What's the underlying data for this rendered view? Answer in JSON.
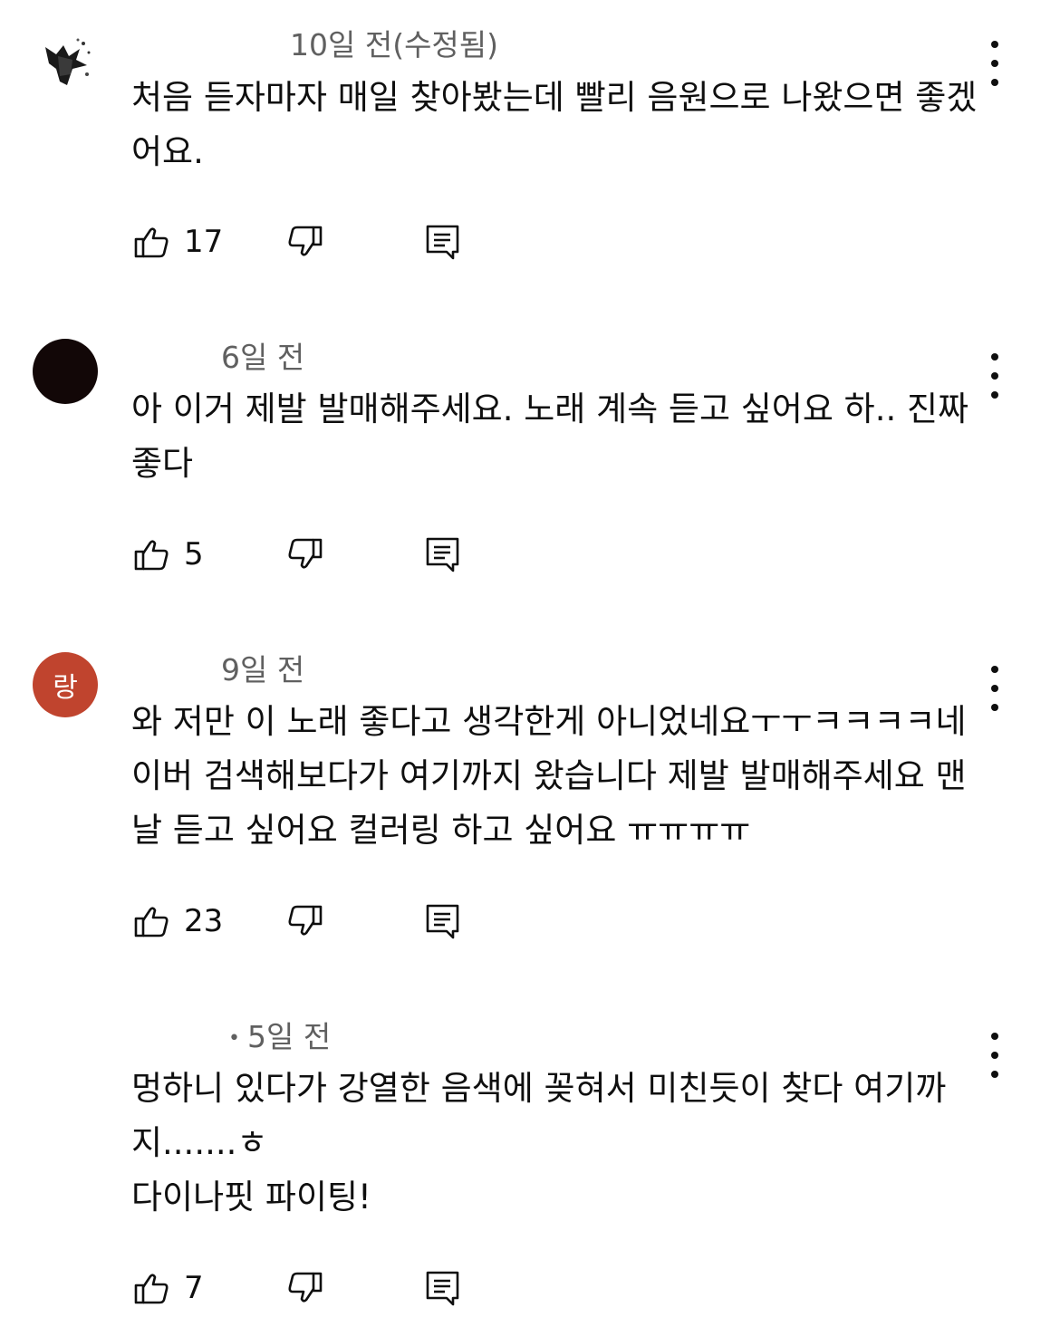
{
  "comments": [
    {
      "time": "10일 전(수정됨)",
      "text": "처음 듣자마자 매일 찾아봤는데 빨리 음원으로 나왔으면 좋겠어요.",
      "likes": "17",
      "avatar_color": "#ffffff",
      "avatar_letter": ""
    },
    {
      "time": "6일 전",
      "text": "아 이거 제발 발매해주세요. 노래 계속 듣고 싶어요 하.. 진짜 좋다",
      "likes": "5",
      "avatar_color": "#120707",
      "avatar_letter": ""
    },
    {
      "time": "9일 전",
      "text": "와 저만 이 노래 좋다고 생각한게 아니었네요ㅜㅜㅋㅋㅋㅋ네이버 검색해보다가 여기까지 왔습니다 제발 발매해주세요 맨날 듣고 싶어요 컬러링 하고 싶어요 ㅠㅠㅠㅠ",
      "likes": "23",
      "avatar_color": "#c0442e",
      "avatar_letter": "랑"
    },
    {
      "time": "5일 전",
      "dot": "•",
      "text": "멍하니 있다가 강열한 음색에 꽂혀서 미친듯이 찾다 여기까지.......ㅎ\n다이나핏 파이팅!",
      "likes": "7",
      "avatar_color": "",
      "avatar_letter": ""
    }
  ],
  "icons": {
    "like": "thumbs-up-icon",
    "dislike": "thumbs-down-icon",
    "reply": "reply-comment-icon",
    "menu": "more-vertical-icon"
  }
}
